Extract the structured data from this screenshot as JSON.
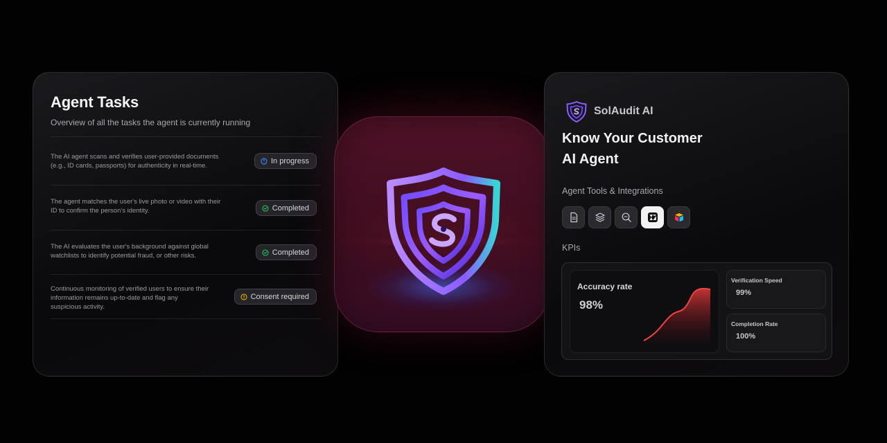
{
  "tasks_panel": {
    "title": "Agent Tasks",
    "subtitle": "Overview of all the tasks the agent is currently running",
    "tasks": [
      {
        "description": "The AI agent scans and verifies user-provided  documents\n (e.g., ID cards, passports) for authenticity in real-time.",
        "status": "In progress",
        "status_icon": "progress-icon",
        "status_color": "#3b82f6"
      },
      {
        "description": "The agent matches the user's live photo or video with their\n ID to confirm the person's identity.",
        "status": "Completed",
        "status_icon": "check-circle-icon",
        "status_color": "#22c55e"
      },
      {
        "description": "The AI evaluates the user's background against global\nwatchlists to identify potential fraud, or other risks.",
        "status": "Completed",
        "status_icon": "check-circle-icon",
        "status_color": "#22c55e"
      },
      {
        "description": "Continuous monitoring of verified users to ensure their\n information remains up-to-date and flag any\nsuspicious activity.",
        "status": "Consent required",
        "status_icon": "warning-circle-icon",
        "status_color": "#eab308"
      }
    ]
  },
  "center_logo": {
    "icon": "shield-s-logo-icon"
  },
  "agent_panel": {
    "brand_name": "SolAudit AI",
    "title_line1": "Know Your Customer",
    "title_line2": "AI Agent",
    "tools_label": "Agent Tools & Integrations",
    "tools": [
      {
        "icon": "document-icon"
      },
      {
        "icon": "layers-icon"
      },
      {
        "icon": "search-scan-icon"
      },
      {
        "icon": "zendesk-icon"
      },
      {
        "icon": "airtable-icon"
      }
    ],
    "kpis_label": "KPIs",
    "kpis": {
      "accuracy_label": "Accuracy rate",
      "accuracy_value": "98%",
      "verification_label": "Verification Speed",
      "verification_value": "99%",
      "completion_label": "Completion Rate",
      "completion_value": "100%"
    },
    "accent_color": "#ef4444"
  }
}
